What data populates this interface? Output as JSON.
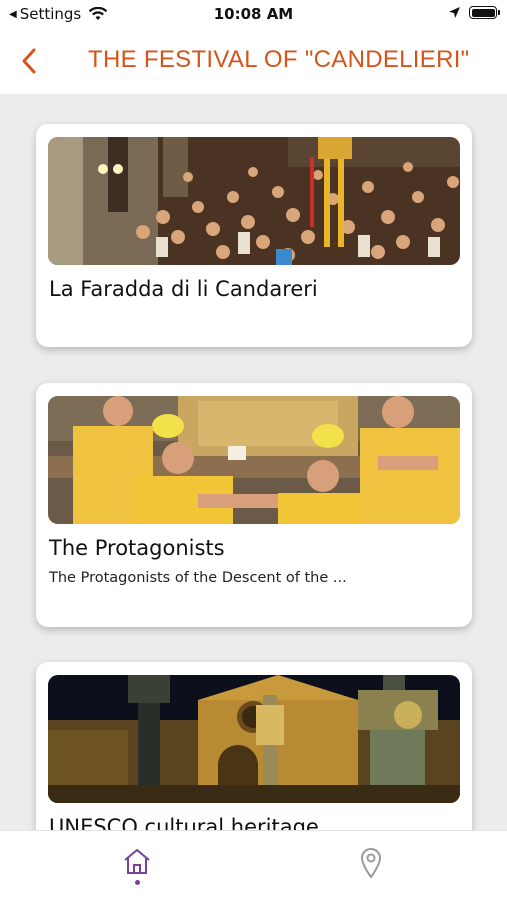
{
  "status_bar": {
    "back_app": "Settings",
    "time": "10:08 AM"
  },
  "header": {
    "title": "THE FESTIVAL OF \"CANDELIERI\""
  },
  "cards": [
    {
      "title": "La Faradda di li Candareri",
      "subtitle": ""
    },
    {
      "title": "The Protagonists",
      "subtitle": "The Protagonists of the Descent of the ..."
    },
    {
      "title": "UNESCO cultural heritage",
      "subtitle": ""
    }
  ],
  "tab_bar": {
    "items": [
      {
        "icon": "home-icon",
        "active": true
      },
      {
        "icon": "location-pin-icon",
        "active": false
      }
    ]
  },
  "colors": {
    "accent": "#d4541b",
    "tab_active": "#7a3e9d",
    "tab_inactive": "#9a9a9a",
    "background": "#ececec"
  }
}
